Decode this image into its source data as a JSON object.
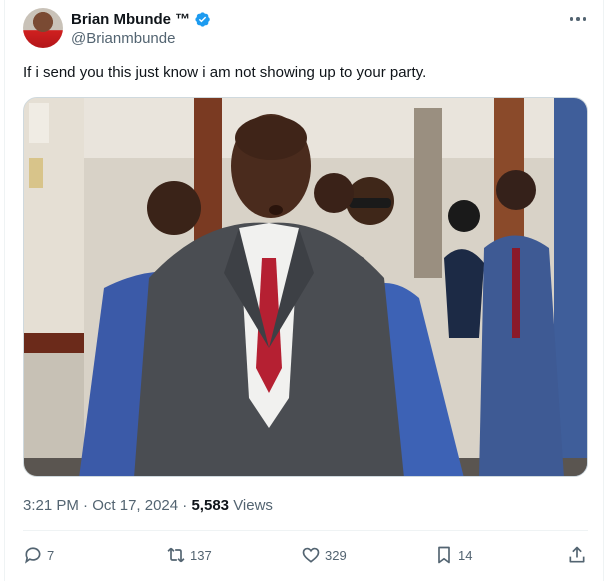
{
  "author": {
    "display_name": "Brian Mbunde ™",
    "handle": "@Brianmbunde",
    "verified": true
  },
  "icons": {
    "verified": "verified-badge-icon",
    "more": "more-options-icon",
    "reply": "reply-icon",
    "retweet": "retweet-icon",
    "like": "like-icon",
    "bookmark": "bookmark-icon",
    "share": "share-icon"
  },
  "tweet": {
    "text": "If i send you this just know i am not showing up to your party."
  },
  "meta": {
    "time": "3:21 PM",
    "separator": "·",
    "date": "Oct 17, 2024",
    "views_count": "5,583",
    "views_label": "Views"
  },
  "actions": {
    "replies": "7",
    "retweets": "137",
    "likes": "329",
    "bookmarks": "14"
  },
  "colors": {
    "text_primary": "#0f1419",
    "text_secondary": "#536471",
    "verified_blue": "#1d9bf0",
    "border": "#eff3f4"
  }
}
